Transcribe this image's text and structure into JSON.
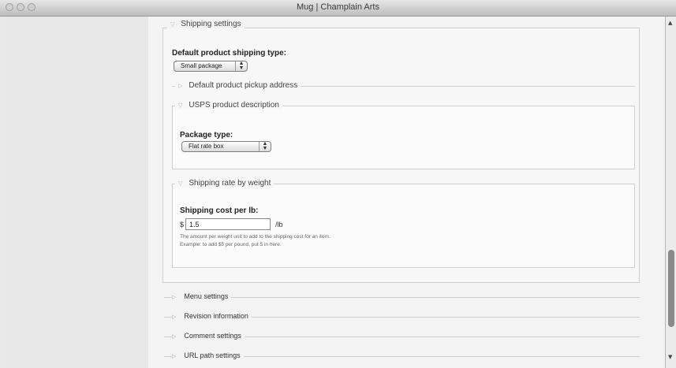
{
  "window": {
    "title": "Mug | Champlain Arts"
  },
  "shipping_settings": {
    "legend": "Shipping settings",
    "default_type_label": "Default product shipping type:",
    "default_type_value": "Small package",
    "pickup_legend": "Default product pickup address",
    "usps": {
      "legend": "USPS product description",
      "package_type_label": "Package type:",
      "package_type_value": "Flat rate box"
    },
    "rate_by_weight": {
      "legend": "Shipping rate by weight",
      "cost_label": "Shipping cost per lb:",
      "currency": "$",
      "cost_value": "1.5",
      "unit": "/lb",
      "help_line1": "The amount per weight unit to add to the shipping cost for an item.",
      "help_line2": "Example: to add $5 per pound, put 5 in here."
    }
  },
  "collapsed_sections": [
    {
      "label": "Menu settings"
    },
    {
      "label": "Revision information"
    },
    {
      "label": "Comment settings"
    },
    {
      "label": "URL path settings"
    }
  ],
  "icons": {
    "collapse_arrow": "triangle-right-icon",
    "select_arrow": "up-down-arrows-icon",
    "scroll_up": "scroll-up-arrow-icon",
    "scroll_down": "scroll-down-arrow-icon"
  }
}
